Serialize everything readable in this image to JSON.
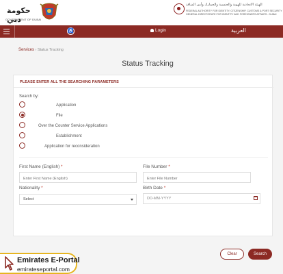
{
  "header": {
    "gov_logo_ar": "حكومة دبي",
    "gov_logo_en": "GOVERNMENT OF DUBAI",
    "authority_ar": "الهيئة الاتحادية للهوية والجنسية والجمارك وأمن المنافذ",
    "authority_en_1": "FEDERAL AUTHORITY FOR IDENTITY, CITIZENSHIP, CUSTOMS & PORT SECURITY",
    "authority_en_2": "GENERAL DIRECTORATE FOR IDENTITY AND FOREIGNERS AFFAIRS - DUBAI"
  },
  "navbar": {
    "login_label": "Login",
    "language_label": "العربية",
    "accessibility_icon": "accessibility-icon",
    "menu_icon": "hamburger-menu-icon"
  },
  "breadcrumb": {
    "root": "Services",
    "separator": "›",
    "current": "Status Tracking"
  },
  "page_title": "Status Tracking",
  "form": {
    "section_heading": "PLEASE ENTER ALL THE SEARCHING PARAMETERS",
    "search_by_label": "Search by:",
    "options": [
      {
        "label": "Application",
        "checked": false
      },
      {
        "label": "File",
        "checked": true
      },
      {
        "label": "Over the Counter Service Applications",
        "checked": false
      },
      {
        "label": "Establishment",
        "checked": false
      },
      {
        "label": "Application for reconsideration",
        "checked": false
      }
    ],
    "first_name": {
      "label": "First Name (English)",
      "required_mark": "*",
      "placeholder": "Enter First Name (English)"
    },
    "file_number": {
      "label": "File Number",
      "required_mark": "*",
      "placeholder": "Enter File Number"
    },
    "nationality": {
      "label": "Nationality",
      "required_mark": "*",
      "selected": "Select"
    },
    "birth_date": {
      "label": "Birth Date",
      "required_mark": "*",
      "placeholder": "DD-MM-YYYY"
    }
  },
  "buttons": {
    "clear_label": "Clear",
    "search_label": "Search"
  },
  "watermark": {
    "title": "Emirates E-Portal",
    "url": "emirateseportal.com"
  },
  "colors": {
    "brand": "#8c2a24",
    "watermark_border": "#e6b521"
  }
}
